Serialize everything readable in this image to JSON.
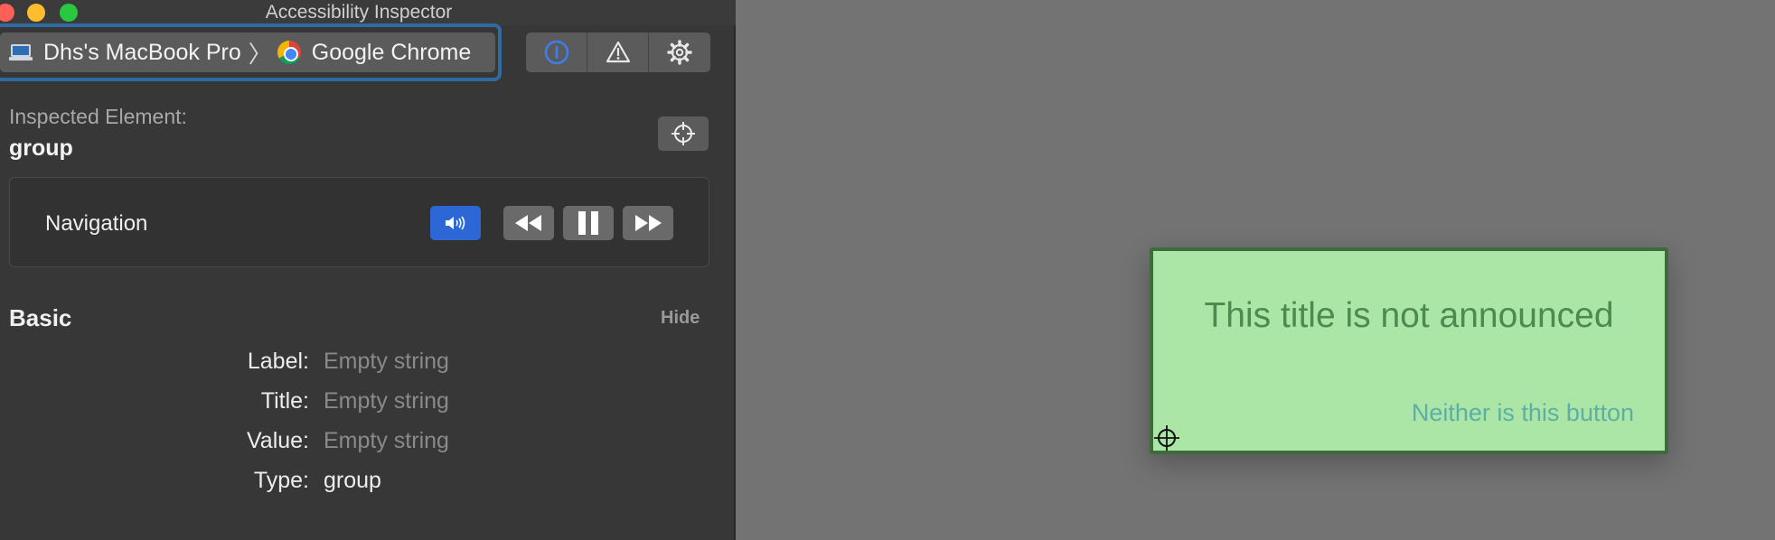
{
  "window": {
    "title": "Accessibility Inspector"
  },
  "target": {
    "host": "Dhs's MacBook Pro",
    "app": "Google Chrome"
  },
  "toolbar": {
    "buttons": [
      {
        "name": "inspection-icon",
        "active": true
      },
      {
        "name": "warning-icon",
        "active": false
      },
      {
        "name": "gear-icon",
        "active": false
      }
    ]
  },
  "inspected": {
    "label": "Inspected Element:",
    "value": "group"
  },
  "navigation": {
    "label": "Navigation"
  },
  "basic": {
    "title": "Basic",
    "hide_label": "Hide",
    "rows": [
      {
        "key": "Label:",
        "value": "Empty string"
      },
      {
        "key": "Title:",
        "value": "Empty string"
      },
      {
        "key": "Value:",
        "value": "Empty string"
      },
      {
        "key": "Type:",
        "value": "group"
      }
    ]
  },
  "page": {
    "card_title": "This title is not announced",
    "card_button": "Neither is this button"
  },
  "colors": {
    "accent": "#2d67d6",
    "focus_ring": "#2f6aa0",
    "card_bg": "#abe6a7",
    "card_title": "#4d8a4e",
    "card_button": "#5eaea6"
  }
}
